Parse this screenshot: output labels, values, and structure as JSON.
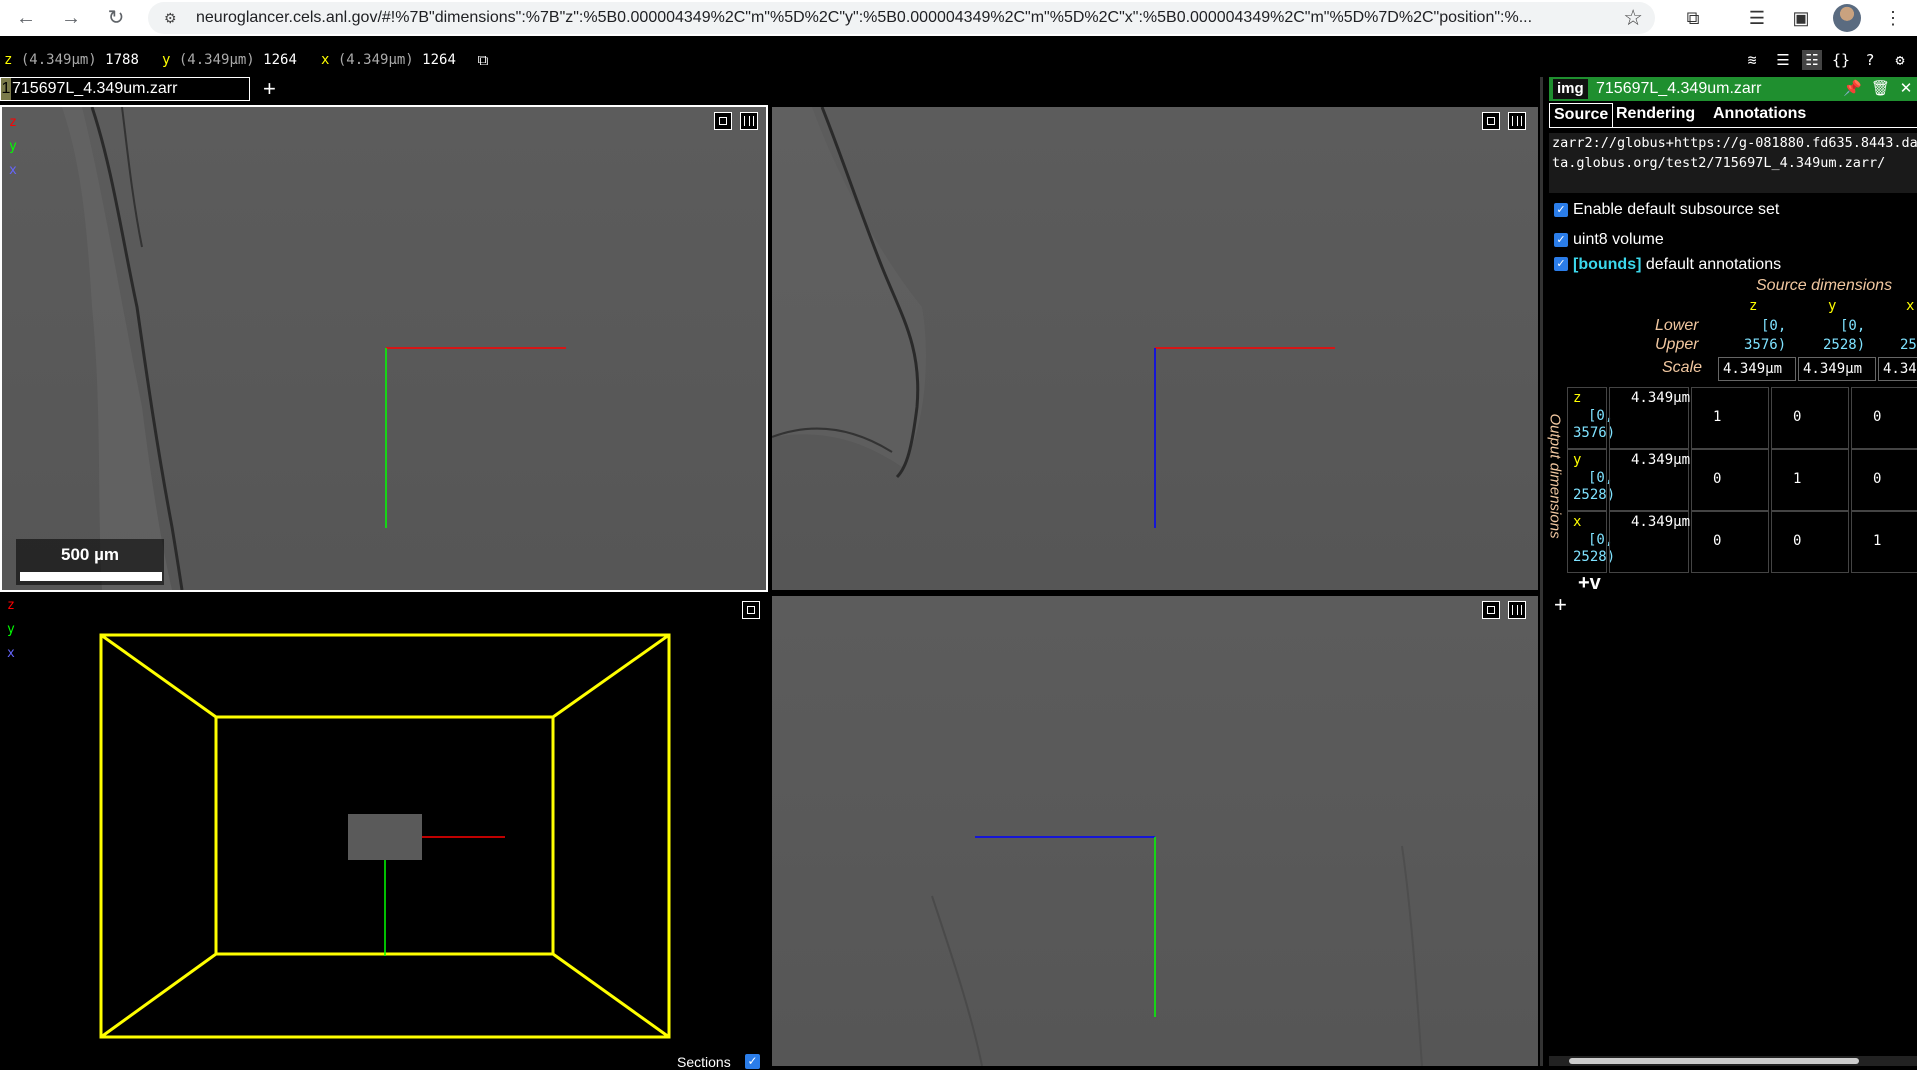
{
  "browser": {
    "url": "neuroglancer.cels.anl.gov/#!%7B\"dimensions\":%7B\"z\":%5B0.000004349%2C\"m\"%5D%2C\"y\":%5B0.000004349%2C\"m\"%5D%2C\"x\":%5B0.000004349%2C\"m\"%5D%7D%2C\"position\":%..."
  },
  "coords": {
    "z": {
      "name": "z",
      "unit": "(4.349μm)",
      "value": "1788"
    },
    "y": {
      "name": "y",
      "unit": "(4.349μm)",
      "value": "1264"
    },
    "x": {
      "name": "x",
      "unit": "(4.349μm)",
      "value": "1264"
    }
  },
  "layer_tab": {
    "index": "1",
    "name": "715697L_4.349um.zarr",
    "add": "+"
  },
  "axes": {
    "z": "z",
    "y": "y",
    "x": "x"
  },
  "scalebar": {
    "label": "500 µm"
  },
  "sections": {
    "label": "Sections"
  },
  "side": {
    "tag": "img",
    "title": "715697L_4.349um.zarr",
    "tabs": [
      "Source",
      "Rendering",
      "Annotations"
    ],
    "source_url": "zarr2://globus+https://g-081880.fd635.8443.data.globus.org/test2/715697L_4.349um.zarr/",
    "enable_default": "Enable default subsource set",
    "uint8": "uint8 volume",
    "bounds_tag": "[bounds]",
    "bounds_label": " default annotations",
    "source_dimensions": "Source dimensions",
    "dim_headers": [
      "z",
      "y",
      "x"
    ],
    "lower_label": "Lower",
    "upper_label": "Upper",
    "scale_label": "Scale",
    "lower": [
      "[0,",
      "[0,",
      ""
    ],
    "upper": [
      "3576)",
      "2528)",
      "25"
    ],
    "scales": [
      "4.349μm",
      "4.349μm",
      "4.34"
    ],
    "output_dimensions": "Output dimensions",
    "out_rows": [
      {
        "name": "z",
        "lo": "[0,",
        "hi": "3576)",
        "scale": "4.349μm",
        "m": [
          "1",
          "0",
          "0"
        ]
      },
      {
        "name": "y",
        "lo": "[0,",
        "hi": "2528)",
        "scale": "4.349μm",
        "m": [
          "0",
          "1",
          "0"
        ]
      },
      {
        "name": "x",
        "lo": "[0,",
        "hi": "2528)",
        "scale": "4.349μm",
        "m": [
          "0",
          "0",
          "1"
        ]
      }
    ],
    "add_v": "+v",
    "add_source": "+"
  },
  "colors": {
    "axis_x": "#ff0000",
    "axis_y": "#00ff00",
    "axis_z": "#0000ff",
    "bbox": "#ffff00",
    "header_green": "#1f8f2f"
  }
}
